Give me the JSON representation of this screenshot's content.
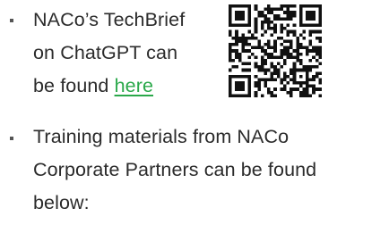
{
  "slide": {
    "items": [
      {
        "lines": [
          "NACo’s TechBrief",
          "on ChatGPT can"
        ],
        "line3_prefix": "be found ",
        "link_label": "here"
      },
      {
        "lines": [
          "Training materials from NACo",
          "Corporate Partners can be found",
          "below:"
        ]
      }
    ],
    "qr_icon": "qr-code-icon",
    "colors": {
      "text": "#2b2b2b",
      "link": "#2aa84a",
      "bullet": "#555555"
    }
  }
}
